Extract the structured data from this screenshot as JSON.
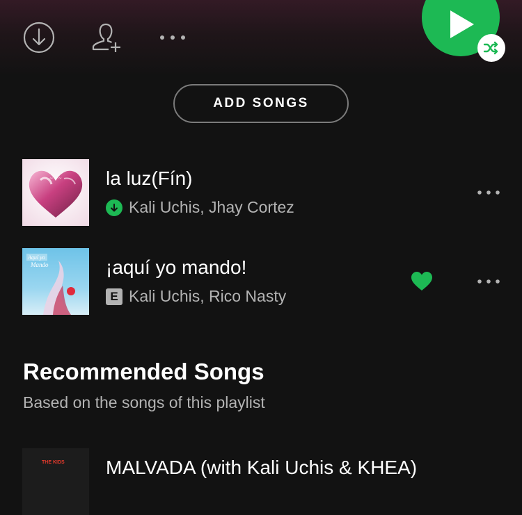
{
  "header": {
    "add_songs_label": "ADD SONGS"
  },
  "tracks": [
    {
      "title": "la luz(Fín)",
      "artists": "Kali Uchis, Jhay Cortez",
      "downloaded": true,
      "liked": false
    },
    {
      "title": "¡aquí yo mando!",
      "artists": "Kali Uchis, Rico Nasty",
      "explicit_label": "E",
      "liked": true
    }
  ],
  "recommended": {
    "title": "Recommended Songs",
    "subtitle": "Based on the songs of this playlist",
    "items": [
      {
        "title": "MALVADA (with Kali Uchis & KHEA)",
        "cover_text": "THE KIDS"
      }
    ]
  },
  "icons": {
    "download": "download-circle-icon",
    "add_user": "add-user-icon",
    "more": "more-horizontal-icon",
    "play": "play-icon",
    "shuffle": "shuffle-icon",
    "heart": "heart-icon"
  },
  "colors": {
    "accent_green": "#1db954",
    "background": "#121212",
    "secondary_text": "#b3b3b3"
  }
}
